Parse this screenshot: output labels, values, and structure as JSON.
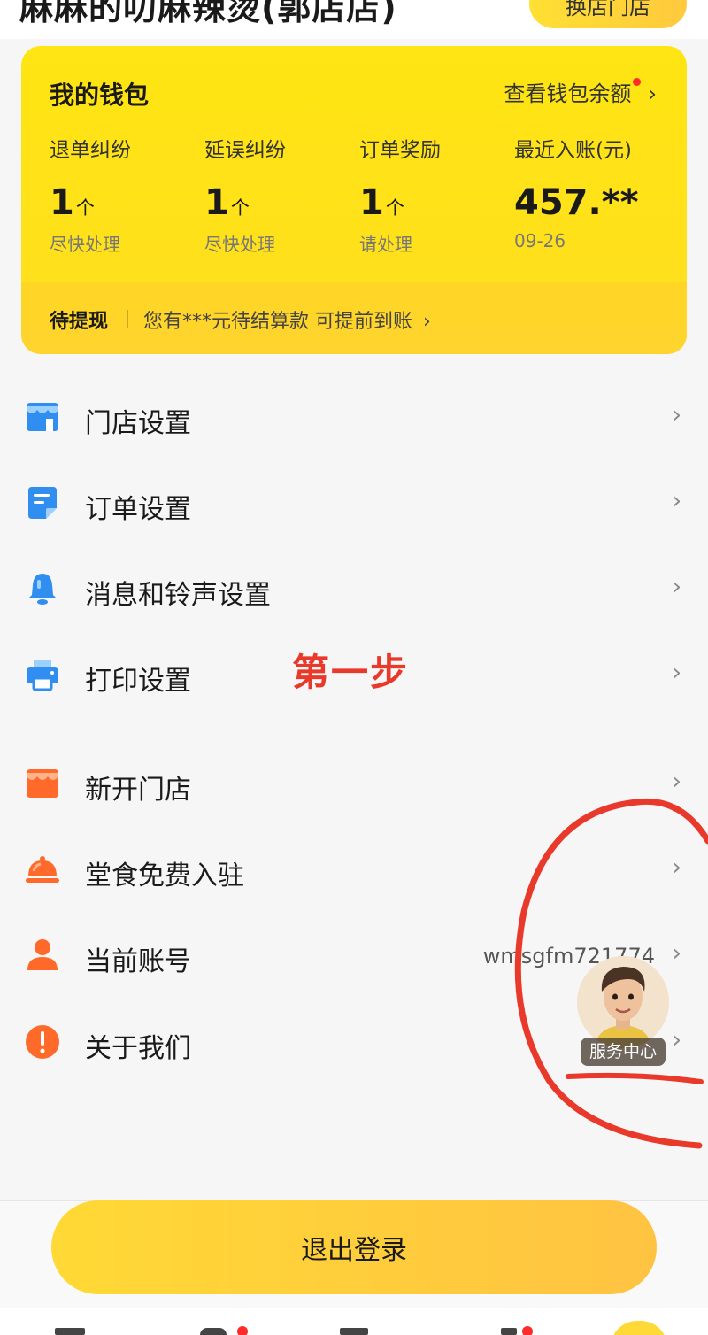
{
  "header": {
    "store_title": "麻麻的叨麻辣烫(郭店店)",
    "switch_store_label": "换店门店"
  },
  "wallet": {
    "title": "我的钱包",
    "balance_link": "查看钱包余额",
    "stats": [
      {
        "label": "退单纠纷",
        "value": "1",
        "unit": "个",
        "sub": "尽快处理"
      },
      {
        "label": "延误纠纷",
        "value": "1",
        "unit": "个",
        "sub": "尽快处理"
      },
      {
        "label": "订单奖励",
        "value": "1",
        "unit": "个",
        "sub": "请处理"
      },
      {
        "label": "最近入账(元)",
        "value": "457.**",
        "unit": "",
        "sub": "09-26"
      }
    ],
    "pending_label": "待提现",
    "pending_text": "您有***元待结算款 可提前到账"
  },
  "menu": {
    "items": [
      {
        "label": "门店设置",
        "icon": "store-icon",
        "color": "#2f8ef0"
      },
      {
        "label": "订单设置",
        "icon": "order-icon",
        "color": "#2f8ef0"
      },
      {
        "label": "消息和铃声设置",
        "icon": "bell-icon",
        "color": "#2f8ef0"
      },
      {
        "label": "打印设置",
        "icon": "printer-icon",
        "color": "#2f8ef0"
      },
      {
        "label": "新开门店",
        "icon": "new-store-icon",
        "color": "#ff6a2b"
      },
      {
        "label": "堂食免费入驻",
        "icon": "dining-cloche-icon",
        "color": "#ff6a2b"
      },
      {
        "label": "当前账号",
        "icon": "user-icon",
        "color": "#ff6a2b",
        "value": "wmsgfm721774"
      },
      {
        "label": "关于我们",
        "icon": "info-icon",
        "color": "#ff6a2b"
      }
    ]
  },
  "annotation": {
    "text": "第一步",
    "color": "#e8392a"
  },
  "service_center": {
    "label": "服务中心"
  },
  "logout": {
    "label": "退出登录"
  },
  "colors": {
    "accent_yellow": "#ffe01c",
    "blue_icon": "#2f8ef0",
    "orange_icon": "#ff6a2b",
    "badge_red": "#ff2a2a"
  }
}
